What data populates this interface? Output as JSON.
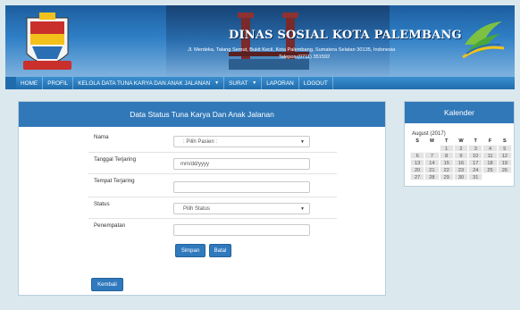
{
  "header": {
    "title": "DINAS SOSIAL KOTA PALEMBANG",
    "address": "Jl. Merdeka, Talang Semut, Bukit Kecil, Kota Palembang, Sumatera Selatan 30135, Indonesia",
    "phone": "Telepon:(0711) 351592"
  },
  "nav": [
    {
      "label": "HOME"
    },
    {
      "label": "PROFIL"
    },
    {
      "label": "KELOLA DATA TUNA KARYA DAN ANAK JALANAN",
      "caret": "▼"
    },
    {
      "label": "SURAT",
      "caret": "▼"
    },
    {
      "label": "LAPORAN"
    },
    {
      "label": "LOGOUT"
    }
  ],
  "form": {
    "title": "Data Status Tuna Karya Dan Anak Jalanan",
    "fields": [
      {
        "label": "Nama",
        "value": ": Pilih Pasien :",
        "type": "select"
      },
      {
        "label": "Tanggal Terjaring",
        "value": "mm/dd/yyyy",
        "type": "date"
      },
      {
        "label": "Tempat Terjaring",
        "value": "",
        "type": "text"
      },
      {
        "label": "Status",
        "value": "Pilih Status",
        "type": "select"
      },
      {
        "label": "Penempatan",
        "value": "",
        "type": "text"
      }
    ],
    "save_label": "Simpan",
    "cancel_label": "Batal",
    "back_label": "Kembali"
  },
  "calendar": {
    "title": "Kalender",
    "month_label": "August (2017)",
    "weekdays": [
      "S",
      "M",
      "T",
      "W",
      "T",
      "F",
      "S"
    ],
    "weeks": [
      [
        "",
        "",
        "1",
        "2",
        "3",
        "4",
        "5"
      ],
      [
        "6",
        "7",
        "8",
        "9",
        "10",
        "11",
        "12"
      ],
      [
        "13",
        "14",
        "15",
        "16",
        "17",
        "18",
        "19"
      ],
      [
        "20",
        "21",
        "22",
        "23",
        "24",
        "25",
        "26"
      ],
      [
        "27",
        "28",
        "29",
        "30",
        "31",
        "",
        ""
      ]
    ]
  },
  "colors": {
    "primary": "#3178b8",
    "nav": "#2a7cc0",
    "page_bg": "#dbe8ee"
  }
}
